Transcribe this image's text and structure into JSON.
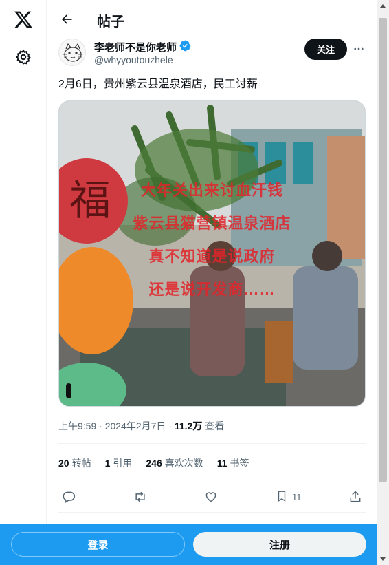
{
  "header": {
    "title": "帖子"
  },
  "post": {
    "author_name": "李老师不是你老师",
    "author_handle": "@whyyoutouzhele",
    "follow_label": "关注",
    "text": "2月6日，贵州紫云县温泉酒店，民工讨薪",
    "media_caption": [
      "大年关出来讨血汗钱",
      "紫云县猫营镇温泉酒店",
      "真不知道是说政府",
      "还是说开发商……"
    ],
    "timestamp": "上午9:59 · 2024年2月7日 · ",
    "views_count": "11.2万",
    "views_label": "查看",
    "stats": [
      {
        "count": "20",
        "label": "转帖"
      },
      {
        "count": "1",
        "label": "引用"
      },
      {
        "count": "246",
        "label": "喜欢次数"
      },
      {
        "count": "11",
        "label": "书签"
      }
    ],
    "bookmark_count": "11"
  },
  "bottom_bar": {
    "login_label": "登录",
    "signup_label": "注册"
  },
  "icons": [
    "x-logo-icon",
    "gear-icon",
    "back-arrow-icon",
    "verified-badge-icon",
    "more-icon",
    "reply-icon",
    "repost-icon",
    "like-icon",
    "bookmark-icon",
    "share-icon"
  ],
  "colors": {
    "accent": "#1d9bf0",
    "text": "#0f1419",
    "muted": "#536471",
    "caption_red": "#e3242b"
  }
}
